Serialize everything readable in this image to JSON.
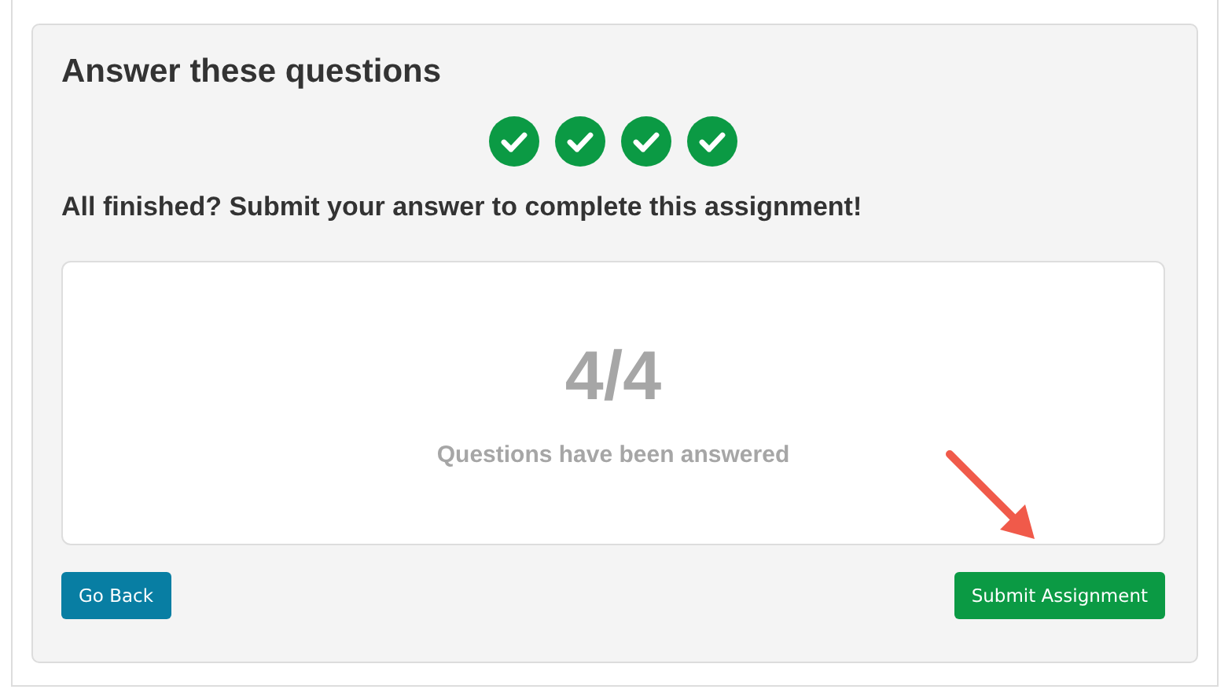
{
  "panel": {
    "title": "Answer these questions",
    "questions": [
      {
        "answered": true
      },
      {
        "answered": true
      },
      {
        "answered": true
      },
      {
        "answered": true
      }
    ],
    "prompt": "All finished? Submit your answer to complete this assignment!",
    "summary": {
      "count": "4/4",
      "caption": "Questions have been answered"
    },
    "buttons": [
      {
        "kind": "back",
        "label": "Go Back"
      },
      {
        "kind": "submit",
        "label": "Submit Assignment"
      }
    ]
  }
}
